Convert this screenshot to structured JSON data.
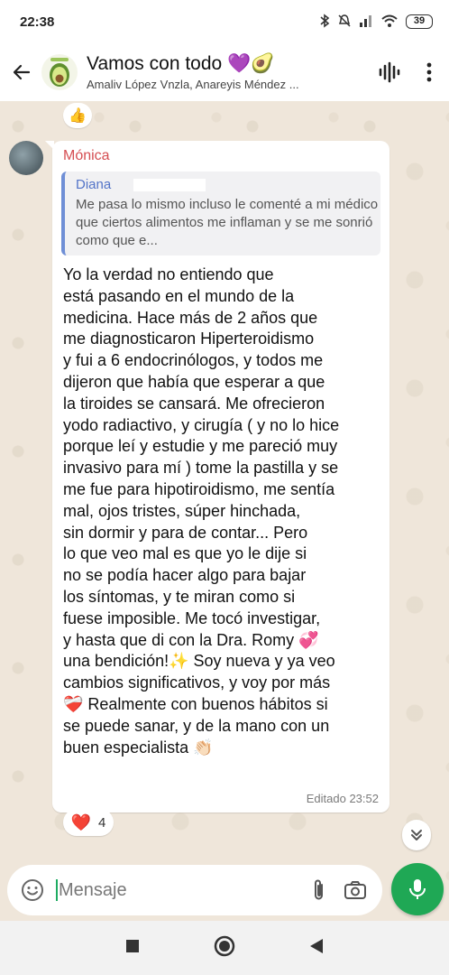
{
  "status_bar": {
    "time": "22:38",
    "battery": "39"
  },
  "header": {
    "title": "Vamos con todo 💜🥑",
    "members": "Amaliv López Vnzla, Anareyis Méndez ..."
  },
  "previous_message": {
    "reaction": "👍"
  },
  "message": {
    "sender": "Mónica",
    "quote": {
      "author": "Diana",
      "text": "Me pasa lo mismo incluso le comenté a mi médico que ciertos alimentos me inflaman y se me sonrió como que e..."
    },
    "lines": [
      "Yo la verdad no entiendo que",
      "está pasando en el mundo de la",
      "medicina. Hace más de 2 años que",
      "me diagnosticaron Hiperteroidismo",
      "y fui a 6 endocrinólogos, y todos me",
      "dijeron que había que esperar a que",
      "la tiroides se cansará. Me ofrecieron",
      "yodo radiactivo, y cirugía ( y no lo hice",
      "porque leí y estudie y me pareció muy",
      "invasivo para mí ) tome la pastilla y se",
      "me fue para hipotiroidismo, me sentía",
      "mal, ojos tristes, súper hinchada,",
      "sin dormir y para de contar... Pero",
      "lo que veo mal es que yo le dije si",
      "no se podía hacer algo para bajar",
      "los síntomas, y te miran como si",
      "fuese imposible. Me tocó investigar,",
      "y hasta que di con la Dra. Romy 💞",
      "una bendición!✨ Soy nueva y ya veo",
      "cambios significativos, y voy por más",
      "❤️‍🩹 Realmente con buenos hábitos si",
      "se puede sanar, y de la mano con un",
      "buen especialista 👏🏻"
    ],
    "edited_label": "Editado",
    "time": "23:52",
    "reaction": {
      "emoji": "❤️",
      "count": "4"
    }
  },
  "composer": {
    "placeholder": "Mensaje"
  },
  "colors": {
    "accent": "#1fa855",
    "sender_name": "#d54e52",
    "quote_author": "#5374c8"
  },
  "icons": [
    "back-arrow-icon",
    "avocado-group-icon",
    "audio-wave-icon",
    "more-vert-icon",
    "chevron-double-down-icon",
    "emoji-icon",
    "paperclip-icon",
    "camera-icon",
    "mic-icon",
    "nav-square-icon",
    "nav-circle-icon",
    "nav-triangle-icon"
  ]
}
